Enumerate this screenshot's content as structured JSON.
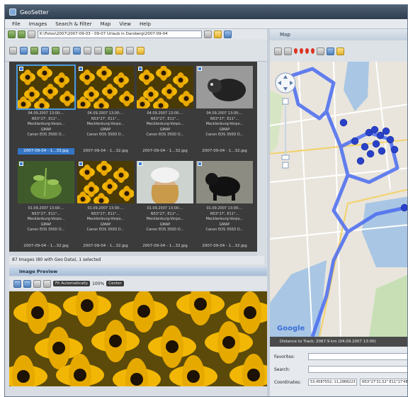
{
  "window": {
    "title": "GeoSetter"
  },
  "menu": [
    "File",
    "Images",
    "Search & Filter",
    "Map",
    "View",
    "Help"
  ],
  "toolbar": {
    "path": "K:\\Fotos\\2007\\2007-09-03 - 09-07 Urlaub in Darsberg\\2007-09-04"
  },
  "thumbnails": [
    {
      "date": "04.09.2007 13:00:...",
      "coords": "N53°27', E11°...",
      "place": "Mecklenburg-Vorpo...",
      "country": "GMAP",
      "camera": "Canon EOS 350D D...",
      "file": "2007-09-04 - 1...33.jpg",
      "photo": "flowers",
      "selected": true
    },
    {
      "date": "04.09.2007 13:00:...",
      "coords": "N53°27', E11°...",
      "place": "Mecklenburg-Vorpo...",
      "country": "GMAP",
      "camera": "Canon EOS 350D D...",
      "file": "2007-09-04 - 1...32.jpg",
      "photo": "flowers",
      "selected": false
    },
    {
      "date": "04.09.2007 13:00:...",
      "coords": "N53°27', E11°...",
      "place": "Mecklenburg-Vorpo...",
      "country": "GMAP",
      "camera": "Canon EOS 350D D...",
      "file": "2007-09-04 - 1...32.jpg",
      "photo": "flowers",
      "selected": false
    },
    {
      "date": "04.09.2007 13:00:...",
      "coords": "N53°27', E11°...",
      "place": "Mecklenburg-Vorpo...",
      "country": "GMAP",
      "camera": "Canon EOS 350D D...",
      "file": "2007-09-04 - 1...32.jpg",
      "photo": "dog-bw",
      "selected": false
    },
    {
      "date": "01.09.2007 13:00:...",
      "coords": "N53°27', E11°...",
      "place": "Mecklenburg-Vorpo...",
      "country": "GMAP",
      "camera": "Canon EOS 350D D...",
      "file": "2007-09-04 - 1...32.jpg",
      "photo": "plant",
      "selected": false
    },
    {
      "date": "01.09.2007 13:00:...",
      "coords": "N53°27', E11°...",
      "place": "Mecklenburg-Vorpo...",
      "country": "GMAP",
      "camera": "Canon EOS 350D D...",
      "file": "2007-09-04 - 1...32.jpg",
      "photo": "flowers",
      "selected": false
    },
    {
      "date": "01.09.2007 13:00:...",
      "coords": "N53°27', E11°...",
      "place": "Mecklenburg-Vorpo...",
      "country": "GMAP",
      "camera": "Canon EOS 350D D...",
      "file": "2007-09-04 - 1...32.jpg",
      "photo": "girl",
      "selected": false
    },
    {
      "date": "01.09.2007 13:00:...",
      "coords": "N53°27', E11°...",
      "place": "Mecklenburg-Vorpo...",
      "country": "GMAP",
      "camera": "Canon EOS 350D D...",
      "file": "2007-09-04 - 1...32.jpg",
      "photo": "dog-black",
      "selected": false
    }
  ],
  "status": "87 Images (80 with Geo Data), 1 selected",
  "preview": {
    "title": "Image Preview",
    "zoom_mode": "Fit Automatically",
    "zoom": "100%",
    "center": "Center"
  },
  "map": {
    "title": "Map",
    "provider": "Google",
    "track_info": "Distance to Track: 2067.9 km (04.09.2007 13:00)"
  },
  "form": {
    "favorites_label": "Favorites:",
    "favorites_value": "",
    "search_label": "Search:",
    "search_value": "",
    "coordinates_label": "Coordinates:",
    "lat": "53,4587552; 11,2968223",
    "lon": "N53°27'31.52\" E11°17'48.56\""
  },
  "colors": {
    "thumb_bg": "#3b3b3b",
    "selection": "#3476c6",
    "track": "#4a6cf0",
    "flower": "#f2b705"
  }
}
